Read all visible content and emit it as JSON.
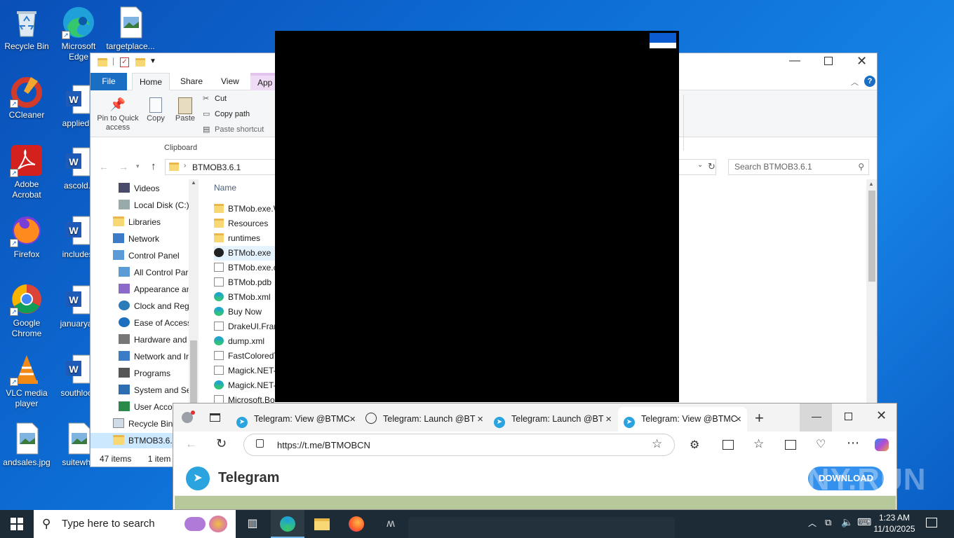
{
  "desktop": {
    "icons": [
      {
        "label": "Recycle Bin"
      },
      {
        "label": "Microsoft Edge"
      },
      {
        "label": "targetplace..."
      },
      {
        "label": "CCleaner"
      },
      {
        "label": "appliediii"
      },
      {
        "label": "Adobe Acrobat"
      },
      {
        "label": "ascold.r"
      },
      {
        "label": "Firefox"
      },
      {
        "label": "includesj"
      },
      {
        "label": "Google Chrome"
      },
      {
        "label": "januaryab"
      },
      {
        "label": "VLC media player"
      },
      {
        "label": "southloca"
      },
      {
        "label": "andsales.jpg"
      },
      {
        "label": "suitewho"
      }
    ]
  },
  "explorer": {
    "ribbon_tabs": [
      "File",
      "Home",
      "Share",
      "View",
      "App"
    ],
    "ribbon": {
      "pin_label": "Pin to Quick access",
      "copy_label": "Copy",
      "paste_label": "Paste",
      "cut_label": "Cut",
      "copy_path_label": "Copy path",
      "paste_shortcut_label": "Paste shortcut",
      "group_label": "Clipboard"
    },
    "address": "BTMOB3.6.1",
    "search_placeholder": "Search BTMOB3.6.1",
    "nav_items": [
      {
        "label": "Videos"
      },
      {
        "label": "Local Disk (C:)"
      },
      {
        "label": "Libraries"
      },
      {
        "label": "Network"
      },
      {
        "label": "Control Panel"
      },
      {
        "label": "All Control Par"
      },
      {
        "label": "Appearance an"
      },
      {
        "label": "Clock and Regi"
      },
      {
        "label": "Ease of Access"
      },
      {
        "label": "Hardware and"
      },
      {
        "label": "Network and Ir"
      },
      {
        "label": "Programs"
      },
      {
        "label": "System and Sec"
      },
      {
        "label": "User Accou"
      },
      {
        "label": "Recycle Bin"
      },
      {
        "label": "BTMOB3.6.1"
      }
    ],
    "column_name": "Name",
    "files": [
      {
        "name": "BTMob.exe.W",
        "icon": "folder"
      },
      {
        "name": "Resources",
        "icon": "folder"
      },
      {
        "name": "runtimes",
        "icon": "folder"
      },
      {
        "name": "BTMob.exe",
        "icon": "app"
      },
      {
        "name": "BTMob.exe.c",
        "icon": "file"
      },
      {
        "name": "BTMob.pdb",
        "icon": "file"
      },
      {
        "name": "BTMob.xml",
        "icon": "edge"
      },
      {
        "name": "Buy Now",
        "icon": "edge"
      },
      {
        "name": "DrakeUI.Fran",
        "icon": "file"
      },
      {
        "name": "dump.xml",
        "icon": "edge"
      },
      {
        "name": "FastColoredT",
        "icon": "file"
      },
      {
        "name": "Magick.NET-",
        "icon": "file"
      },
      {
        "name": "Magick.NET-",
        "icon": "edge"
      },
      {
        "name": "Microsoft.Bo",
        "icon": "file"
      }
    ],
    "status_items": "47 items",
    "status_selected": "1 item"
  },
  "edge": {
    "tabs": [
      {
        "label": "Telegram: View @BTMC"
      },
      {
        "label": "Telegram: Launch @BT"
      },
      {
        "label": "Telegram: Launch @BT"
      },
      {
        "label": "Telegram: View @BTMC"
      }
    ],
    "url": "https://t.me/BTMOBCN",
    "page_brand": "Telegram",
    "download_label": "DOWNLOAD"
  },
  "taskbar": {
    "search_placeholder": "Type here to search",
    "time": "1:23 AM",
    "date": "11/10/2025"
  },
  "watermark": "ANY.RUN"
}
